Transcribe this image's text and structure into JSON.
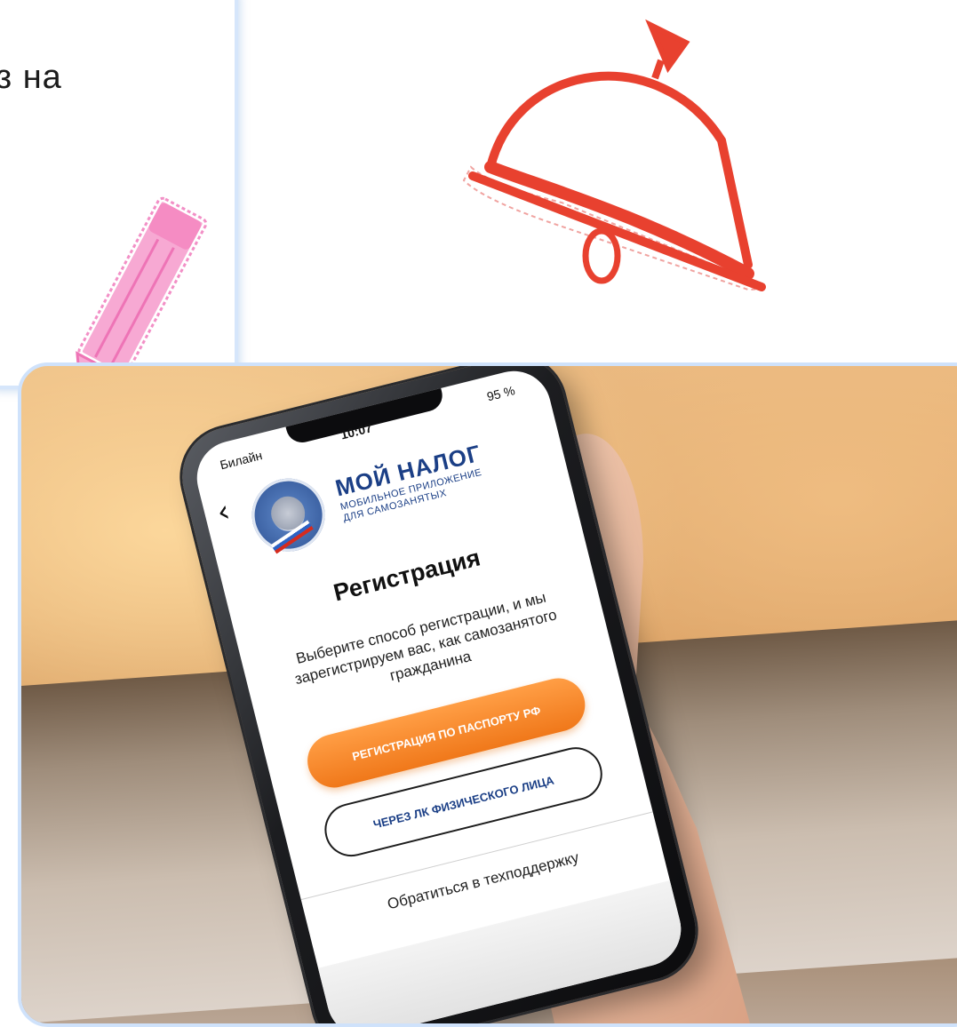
{
  "card": {
    "text": "аз на"
  },
  "phone": {
    "status": {
      "carrier": "Билайн",
      "time": "10:07",
      "battery": "95 %"
    },
    "back_icon": "chevron-left-icon",
    "brand": {
      "name": "МОЙ НАЛОГ",
      "subtitle_line1": "МОБИЛЬНОЕ ПРИЛОЖЕНИЕ",
      "subtitle_line2": "ДЛЯ САМОЗАНЯТЫХ"
    },
    "title": "Регистрация",
    "description": "Выберите способ регистрации, и мы зарегистрируем вас, как самозанятого гражданина",
    "buttons": {
      "passport": "РЕГИСТРАЦИЯ ПО ПАСПОРТУ РФ",
      "lk": "ЧЕРЕЗ ЛК ФИЗИЧЕСКОГО ЛИЦА"
    },
    "support_link": "Обратиться в техподдержку"
  },
  "colors": {
    "accent_orange": "#f0781a",
    "brand_blue": "#1b3f86",
    "bell_red": "#e8412f",
    "pencil_pink": "#f28fc6",
    "frame_blue": "#cfe2fb"
  }
}
